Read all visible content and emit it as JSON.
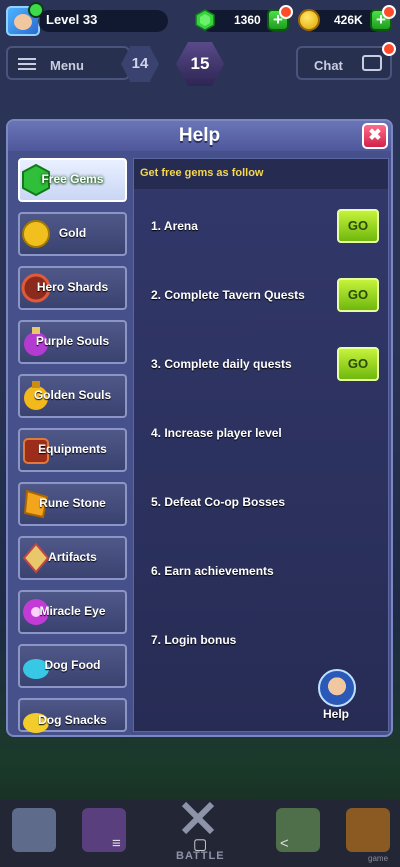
{
  "topbar": {
    "level": "Level 33",
    "gems": "1360",
    "gold": "426K"
  },
  "buttons": {
    "menu": "Menu",
    "chat": "Chat"
  },
  "stages": {
    "previous": "14",
    "current": "15"
  },
  "modal": {
    "title": "Help",
    "close_label": "✖",
    "categories": [
      {
        "label": "Free Gems",
        "icon": "gem-icon",
        "color": "#2fbf3a"
      },
      {
        "label": "Gold",
        "icon": "gold-coin-icon",
        "color": "#f2c01e"
      },
      {
        "label": "Hero Shards",
        "icon": "hero-shard-icon",
        "color": "#8a2b1e"
      },
      {
        "label": "Purple Souls",
        "icon": "purple-soul-icon",
        "color": "#b43bd1"
      },
      {
        "label": "Golden Souls",
        "icon": "golden-soul-icon",
        "color": "#f3b91c"
      },
      {
        "label": "Equipments",
        "icon": "equipment-icon",
        "color": "#9c2d1a"
      },
      {
        "label": "Rune Stone",
        "icon": "rune-stone-icon",
        "color": "#f3a51d"
      },
      {
        "label": "Artifacts",
        "icon": "artifact-icon",
        "color": "#e8c86a"
      },
      {
        "label": "Miracle Eye",
        "icon": "miracle-eye-icon",
        "color": "#c23bd6"
      },
      {
        "label": "Dog Food",
        "icon": "dog-food-icon",
        "color": "#39c7e6"
      },
      {
        "label": "Dog Snacks",
        "icon": "dog-snack-icon",
        "color": "#f1cc2a"
      }
    ],
    "heading": "Get free gems as follow",
    "quests": [
      {
        "label": "1. Arena",
        "go": "GO"
      },
      {
        "label": "2. Complete Tavern Quests",
        "go": "GO"
      },
      {
        "label": "3. Complete daily quests",
        "go": "GO"
      },
      {
        "label": "4. Increase player level"
      },
      {
        "label": "5. Defeat Co-op Bosses"
      },
      {
        "label": "6. Earn achievements"
      },
      {
        "label": "7. Login bonus"
      }
    ],
    "help_label": "Help"
  },
  "bottom_nav": {
    "battle": "BATTLE"
  },
  "system_nav": {
    "menu": "≡",
    "home": "▢",
    "back": "<"
  },
  "watermark": "game"
}
